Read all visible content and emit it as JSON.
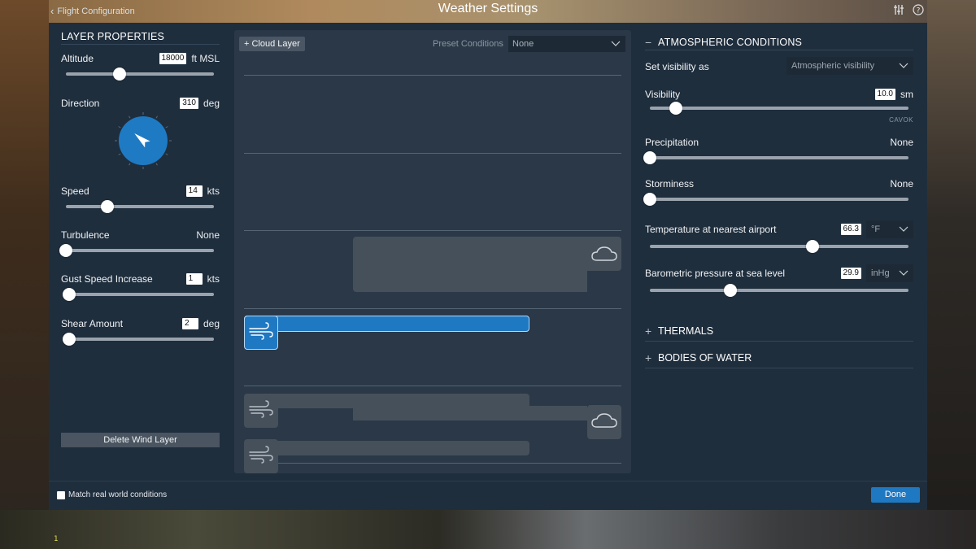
{
  "header": {
    "back_label": "Flight Configuration",
    "title": "Weather Settings",
    "icon_right_1": "sliders-icon",
    "icon_right_2": "help-icon"
  },
  "layer_properties": {
    "title": "LAYER PROPERTIES",
    "altitude": {
      "label": "Altitude",
      "value": "18000",
      "unit": "ft MSL",
      "slider": 0.36
    },
    "direction": {
      "label": "Direction",
      "value": "310",
      "unit": "deg",
      "degrees": 310
    },
    "speed": {
      "label": "Speed",
      "value": "14",
      "unit": "kts",
      "slider": 0.28
    },
    "turbulence": {
      "label": "Turbulence",
      "value": "None",
      "slider": 0.0
    },
    "gust": {
      "label": "Gust Speed Increase",
      "value": "1",
      "unit": "kts",
      "slider": 0.02
    },
    "shear": {
      "label": "Shear Amount",
      "value": "2",
      "unit": "deg",
      "slider": 0.02
    },
    "delete_label": "Delete Wind Layer"
  },
  "center": {
    "cloud_layer_button": "+ Cloud Layer",
    "preset_label": "Preset Conditions",
    "preset_value": "None"
  },
  "atmospheric": {
    "title": "ATMOSPHERIC CONDITIONS",
    "visibility_mode": {
      "label": "Set visibility as",
      "value": "Atmospheric visibility"
    },
    "visibility": {
      "label": "Visibility",
      "value": "10.0",
      "unit": "sm",
      "note": "CAVOK",
      "slider": 0.1
    },
    "precipitation": {
      "label": "Precipitation",
      "value": "None",
      "slider": 0.0
    },
    "storminess": {
      "label": "Storminess",
      "value": "None",
      "slider": 0.0
    },
    "temperature": {
      "label": "Temperature at nearest airport",
      "value": "66.3",
      "unit": "°F",
      "slider": 0.63
    },
    "pressure": {
      "label": "Barometric pressure at sea level",
      "value": "29.9",
      "unit": "inHg",
      "slider": 0.31
    }
  },
  "sections": {
    "thermals": "THERMALS",
    "bodies_of_water": "BODIES OF WATER",
    "expand_symbol": "+",
    "collapse_symbol": "−"
  },
  "footer": {
    "match_label": "Match real world conditions",
    "done_label": "Done"
  },
  "scenery": {
    "bottom_number": "1"
  },
  "colors": {
    "accent": "#1f78c2",
    "panel": "#1f2e3d"
  }
}
